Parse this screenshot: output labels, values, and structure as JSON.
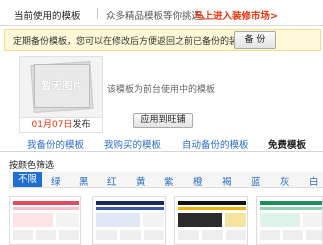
{
  "header": {
    "title": "当前使用的模板",
    "hint": "众多精品模板等你挑选，",
    "market_link": "马上进入装修市场>"
  },
  "notice": {
    "text": "定期备份模板，您可以在修改后方便返回之前已备份的装修。",
    "backup_button": "备 份"
  },
  "current_template": {
    "thumb_label": "暂无图片",
    "date_colored": "01月07日",
    "date_suffix": "发布",
    "description": "该模板为前台使用中的模板",
    "apply_button": "应用到旺铺"
  },
  "tabs": [
    {
      "label": "我备份的模板"
    },
    {
      "label": "我购买的模板"
    },
    {
      "label": "自动备份的模板"
    },
    {
      "label": "免费模板"
    }
  ],
  "active_tab": "免费模板",
  "color_filter": {
    "title": "按颜色筛选",
    "options": [
      "不限",
      "绿",
      "黑",
      "红",
      "黄",
      "紫",
      "橙",
      "褐",
      "蓝",
      "灰",
      "白"
    ],
    "selected": "不限"
  },
  "colors": {
    "accent_red": "#e8340e",
    "link_blue": "#2b6ec2",
    "selected_bg": "#1f6fd1",
    "notice_bg": "#fff7d6"
  }
}
